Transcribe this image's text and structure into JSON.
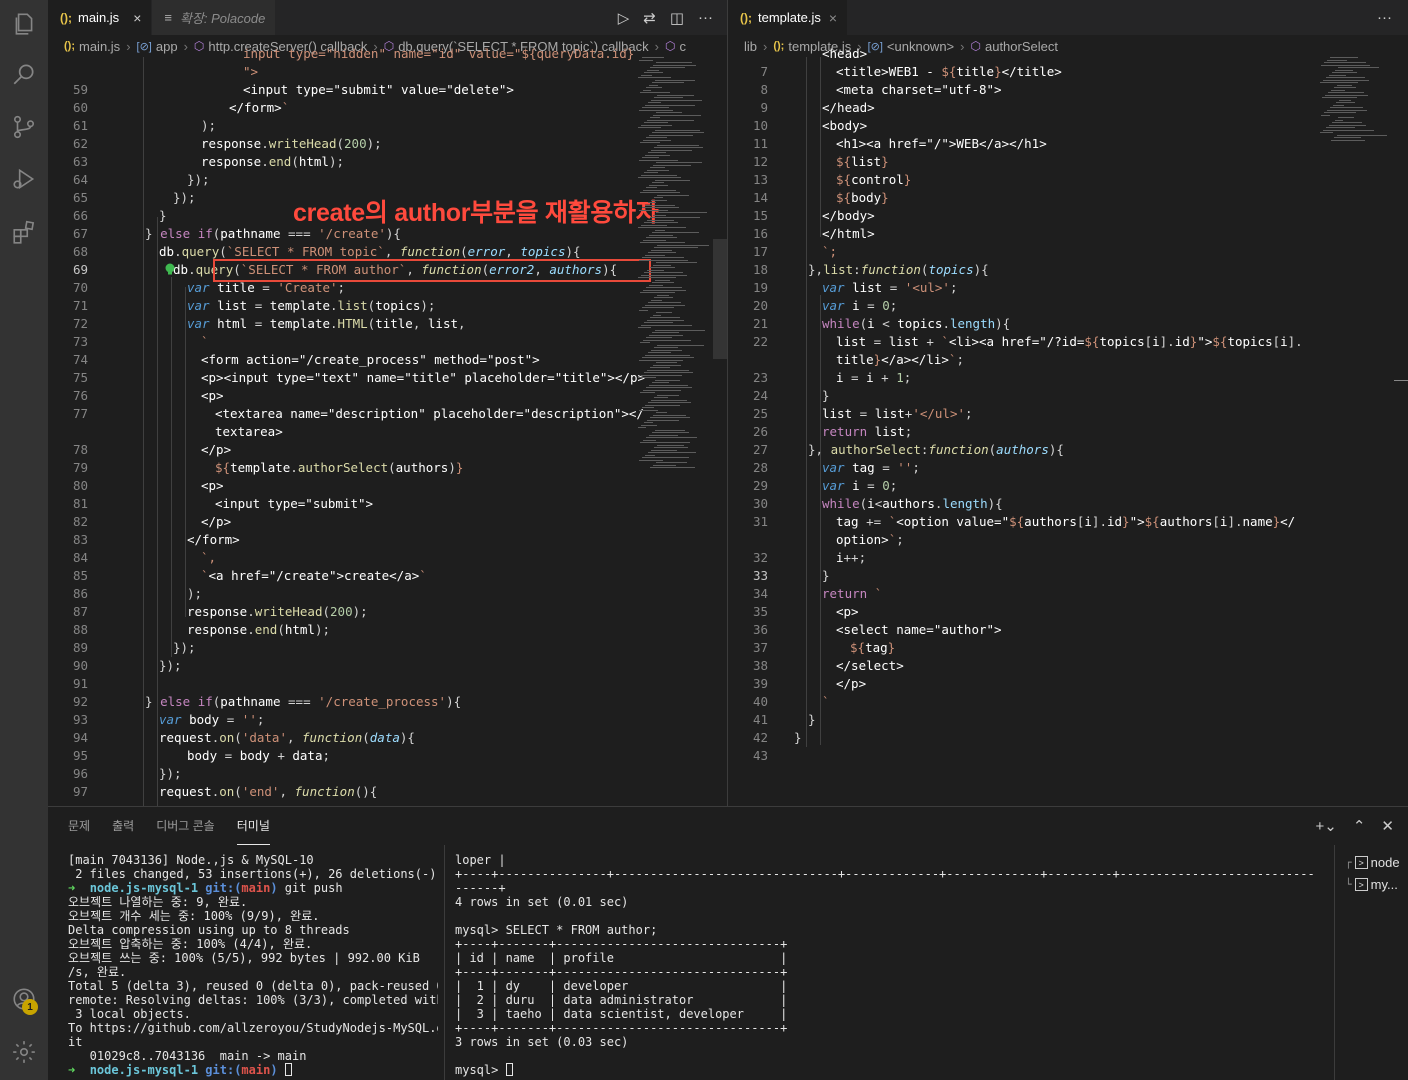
{
  "left_editor": {
    "tabs": [
      {
        "icon": "(); ",
        "label": "main.js",
        "close": "×"
      },
      {
        "icon": "≡",
        "label": "확장: Polacode"
      }
    ],
    "breadcrumb": [
      "main.js",
      "app",
      "http.createServer() callback",
      "db.query(`SELECT * FROM topic`) callback",
      "c"
    ],
    "annotation": "create의 author부분을 재활용하자",
    "line_numbers": [
      "59",
      "60",
      "61",
      "62",
      "63",
      "64",
      "65",
      "66",
      "67",
      "68",
      "69",
      "70",
      "71",
      "72",
      "73",
      "74",
      "75",
      "76",
      "77",
      "",
      "78",
      "79",
      "80",
      "81",
      "82",
      "83",
      "84",
      "85",
      "86",
      "87",
      "88",
      "89",
      "90",
      "91",
      "92",
      "93",
      "94",
      "95",
      "96",
      "97"
    ]
  },
  "right_editor": {
    "tabs": [
      {
        "icon": "(); ",
        "label": "template.js",
        "close": "×"
      }
    ],
    "breadcrumb": [
      "lib",
      "template.js",
      "<unknown>",
      "authorSelect"
    ],
    "line_numbers": [
      "7",
      "8",
      "9",
      "10",
      "11",
      "12",
      "13",
      "14",
      "15",
      "16",
      "17",
      "18",
      "19",
      "20",
      "21",
      "22",
      "",
      "23",
      "24",
      "25",
      "26",
      "27",
      "28",
      "29",
      "30",
      "31",
      "",
      "32",
      "33",
      "34",
      "35",
      "36",
      "37",
      "38",
      "39",
      "40",
      "41",
      "42",
      "43"
    ]
  },
  "panel": {
    "tabs": [
      "문제",
      "출력",
      "디버그 콘솔",
      "터미널"
    ],
    "active_tab": "터미널",
    "terminal_list": [
      "node",
      "my..."
    ],
    "left_terminal": [
      "[main 7043136] Node.,js & MySQL-10",
      " 2 files changed, 53 insertions(+), 26 deletions(-)",
      "PROMPT1",
      "오브젝트 나열하는 중: 9, 완료.",
      "오브젝트 개수 세는 중: 100% (9/9), 완료.",
      "Delta compression using up to 8 threads",
      "오브젝트 압축하는 중: 100% (4/4), 완료.",
      "오브젝트 쓰는 중: 100% (5/5), 992 bytes | 992.00 KiB",
      "/s, 완료.",
      "Total 5 (delta 3), reused 0 (delta 0), pack-reused 0",
      "remote: Resolving deltas: 100% (3/3), completed with",
      " 3 local objects.",
      "To https://github.com/allzeroyou/StudyNodejs-MySQL.g",
      "it",
      "   01029c8..7043136  main -> main",
      "PROMPT2"
    ],
    "prompt": {
      "arrow": "➜",
      "dir": "node.js-mysql-1",
      "git": "git:(",
      "branch": "main",
      "git_close": ")",
      "cmd1": "git push"
    },
    "right_terminal": [
      "loper |",
      "+----+---------------+-------------------------------+-------------+-------------+---------+-------------------------------------",
      "------+",
      "4 rows in set (0.01 sec)",
      "",
      "mysql> SELECT * FROM author;",
      "+----+-------+-------------------------------+",
      "| id | name  | profile                       |",
      "+----+-------+-------------------------------+",
      "|  1 | dy    | developer                     |",
      "|  2 | duru  | data administrator            |",
      "|  3 | taeho | data scientist, developer     |",
      "+----+-------+-------------------------------+",
      "3 rows in set (0.03 sec)",
      "",
      "mysql> "
    ]
  },
  "activity_badge": "1"
}
